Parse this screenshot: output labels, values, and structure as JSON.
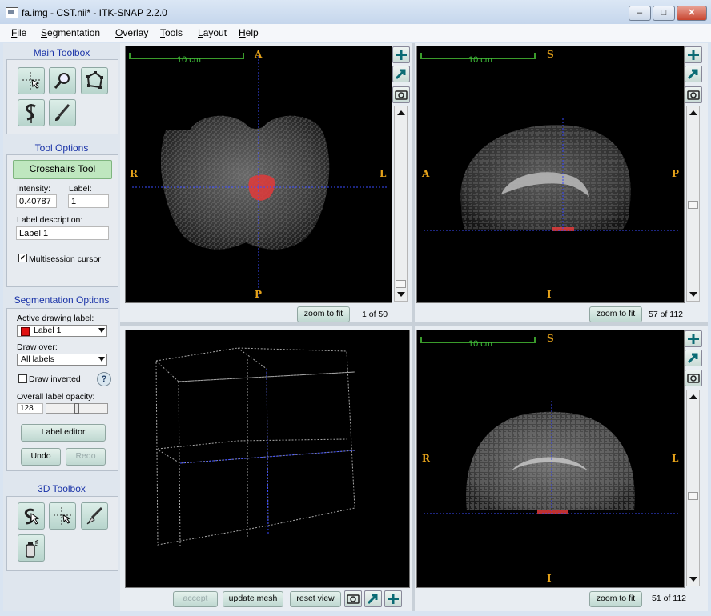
{
  "window": {
    "title": "fa.img - CST.nii* - ITK-SNAP 2.2.0",
    "min": "–",
    "max": "□",
    "close": "✕"
  },
  "menu": [
    "File",
    "Segmentation",
    "Overlay",
    "Tools",
    "Layout",
    "Help"
  ],
  "main_toolbox": {
    "title": "Main Toolbox",
    "tools": [
      "crosshairs-tool",
      "zoom-tool",
      "polygon-tool",
      "snake-tool",
      "paintbrush-tool"
    ]
  },
  "tool_options": {
    "title": "Tool Options",
    "active_tool": "Crosshairs Tool",
    "intensity_label": "Intensity:",
    "intensity_value": "0.40787",
    "label_label": "Label:",
    "label_value": "1",
    "description_label": "Label description:",
    "description_value": "Label 1",
    "multisession_label": "Multisession cursor",
    "multisession_checked": true
  },
  "segmentation_options": {
    "title": "Segmentation Options",
    "active_label_caption": "Active drawing label:",
    "active_label": "Label 1",
    "active_label_color": "#e01010",
    "draw_over_caption": "Draw over:",
    "draw_over": "All labels",
    "draw_inverted_label": "Draw inverted",
    "draw_inverted_checked": false,
    "help": "?",
    "opacity_caption": "Overall label opacity:",
    "opacity_value": "128",
    "opacity_fraction": 0.5,
    "label_editor": "Label editor",
    "undo": "Undo",
    "redo": "Redo"
  },
  "toolbox_3d": {
    "title": "3D Toolbox",
    "tools": [
      "trackball-tool",
      "crosshairs-3d-tool",
      "scalpel-tool",
      "spray-tool"
    ]
  },
  "views": {
    "axial": {
      "scale": "10 cm",
      "top": "A",
      "bottom": "P",
      "left": "R",
      "right": "L",
      "zoom": "zoom to fit",
      "slice": "1 of 50"
    },
    "sagittal": {
      "scale": "10 cm",
      "top": "S",
      "bottom": "I",
      "left": "A",
      "right": "P",
      "zoom": "zoom to fit",
      "slice": "57 of 112"
    },
    "render3d": {
      "accept": "accept",
      "update": "update mesh",
      "reset": "reset view"
    },
    "coronal": {
      "scale": "10 cm",
      "top": "S",
      "bottom": "I",
      "left": "R",
      "right": "L",
      "zoom": "zoom to fit",
      "slice": "51 of 112"
    }
  },
  "colors": {
    "accent_text": "#1a33a8",
    "orientation": "#e5a21a",
    "ruler": "#3fbe3a",
    "crosshair": "#3a4bff",
    "segmentation": "#e03a3a"
  }
}
